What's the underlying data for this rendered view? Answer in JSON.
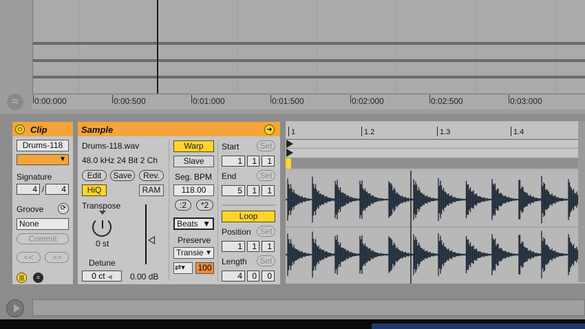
{
  "arrangement": {
    "ruler": [
      "0:00:000",
      "0:00:500",
      "0:01:000",
      "0:01:500",
      "0:02:000",
      "0:02:500",
      "0:03:000"
    ]
  },
  "clip": {
    "title": "Clip",
    "name": "Drums-118",
    "signature_label": "Signature",
    "sig_num": "4",
    "sig_slash": "/",
    "sig_den": "4",
    "groove_label": "Groove",
    "groove_value": "None",
    "commit_label": "Commit",
    "nudge_back": "<<",
    "nudge_fwd": ">>"
  },
  "sample": {
    "title": "Sample",
    "filename": "Drums-118.wav",
    "format": "48.0 kHz 24 Bit 2 Ch",
    "edit": "Edit",
    "save": "Save",
    "rev": "Rev.",
    "hiq": "HiQ",
    "ram": "RAM",
    "transpose_label": "Transpose",
    "transpose_value": "0 st",
    "detune_label": "Detune",
    "detune_value": "0 ct",
    "gain_value": "0.00 dB",
    "warp": "Warp",
    "slave": "Slave",
    "seg_bpm_label": "Seg. BPM",
    "seg_bpm": "118.00",
    "half": ":2",
    "double": "*2",
    "warp_mode": "Beats",
    "preserve_label": "Preserve",
    "preserve_value": "Transie",
    "loop_mode_value": "100",
    "start_label": "Start",
    "end_label": "End",
    "set": "Set",
    "start": [
      "1",
      "1",
      "1"
    ],
    "end": [
      "5",
      "1",
      "1"
    ],
    "loop": "Loop",
    "position_label": "Position",
    "position": [
      "1",
      "1",
      "1"
    ],
    "length_label": "Length",
    "length": [
      "4",
      "0",
      "0"
    ]
  },
  "waveform": {
    "markers": [
      "1",
      "1.2",
      "1.3",
      "1.4"
    ]
  },
  "colors": {
    "accent": "#f4a43a",
    "active_button": "#ffd52b",
    "orange_value": "#f08a3e",
    "panel": "#c6c6c6"
  }
}
